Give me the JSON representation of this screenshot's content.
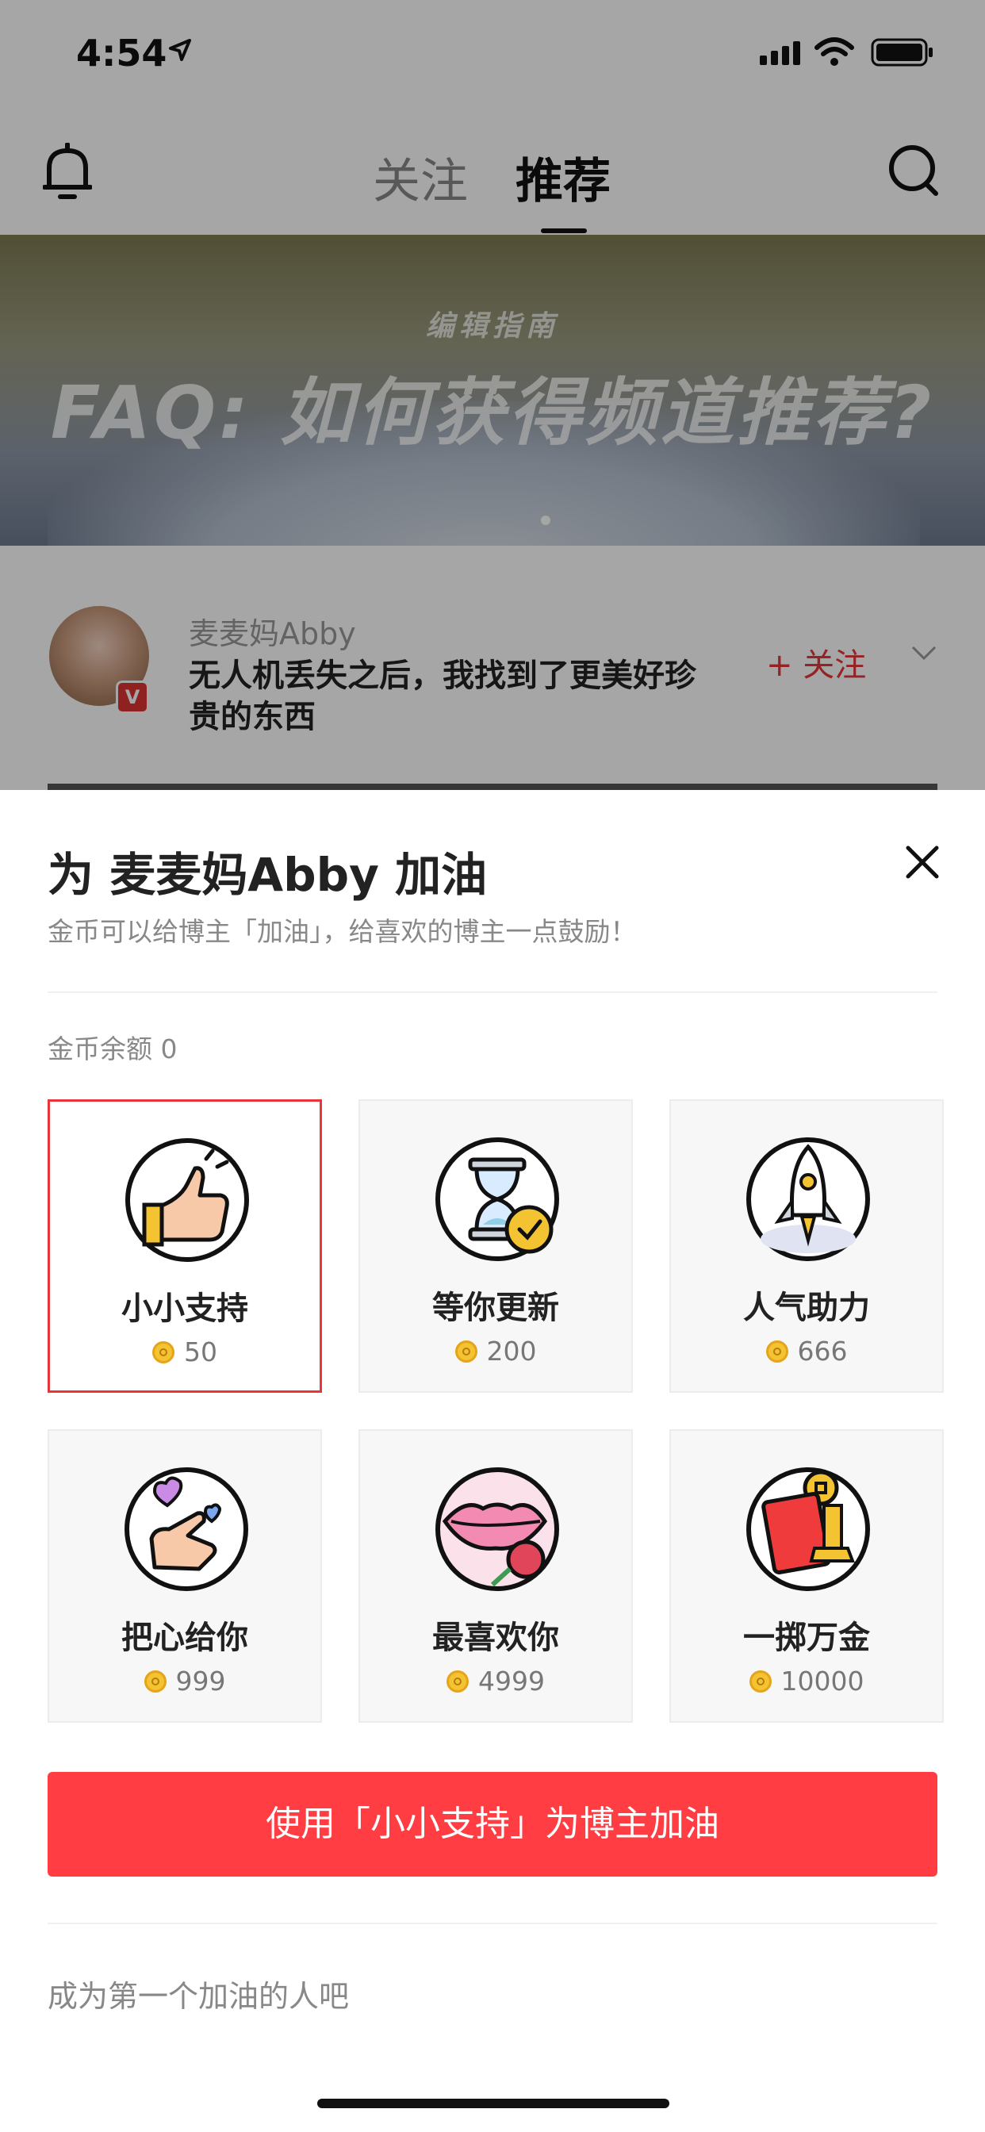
{
  "status_bar": {
    "time": "4:54"
  },
  "top_nav": {
    "tabs": [
      {
        "label": "关注"
      },
      {
        "label": "推荐"
      }
    ]
  },
  "banner": {
    "subtitle": "编辑指南",
    "title": "FAQ: 如何获得频道推荐?"
  },
  "post": {
    "author": "麦麦妈Abby",
    "title": "无人机丢失之后，我找到了更美好珍贵的东西",
    "follow_label": "+ 关注",
    "verified_badge": "V"
  },
  "sheet": {
    "title": "为 麦麦妈Abby 加油",
    "subtitle": "金币可以给博主「加油」，给喜欢的博主一点鼓励！",
    "balance": "金币余额 0",
    "gifts": [
      {
        "name": "小小支持",
        "price": "50",
        "selected": true,
        "icon": "thumbs-up-icon"
      },
      {
        "name": "等你更新",
        "price": "200",
        "selected": false,
        "icon": "hourglass-icon"
      },
      {
        "name": "人气助力",
        "price": "666",
        "selected": false,
        "icon": "rocket-icon"
      },
      {
        "name": "把心给你",
        "price": "999",
        "selected": false,
        "icon": "finger-heart-icon"
      },
      {
        "name": "最喜欢你",
        "price": "4999",
        "selected": false,
        "icon": "lips-rose-icon"
      },
      {
        "name": "一掷万金",
        "price": "10000",
        "selected": false,
        "icon": "red-envelope-icon"
      }
    ],
    "cta_label": "使用「小小支持」为博主加油",
    "empty_message": "成为第一个加油的人吧"
  },
  "colors": {
    "accent": "#ff3d43",
    "selected_border": "#e8353a",
    "coin": "#f3c332"
  }
}
